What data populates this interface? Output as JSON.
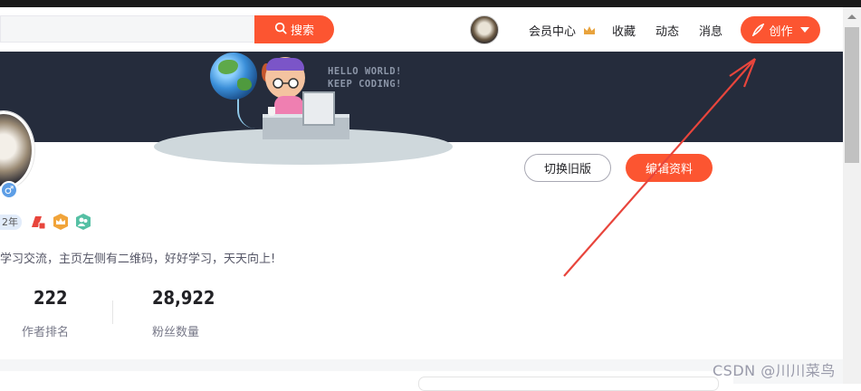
{
  "header": {
    "search": {
      "value": "",
      "placeholder": ""
    },
    "search_button_label": "搜索",
    "nav_items": [
      "会员中心",
      "收藏",
      "动态",
      "消息"
    ],
    "create_button_label": "创作"
  },
  "banner": {
    "text_line1": "HELLO WORLD!",
    "text_line2": "KEEP CODING!"
  },
  "profile": {
    "year_badge": "2年",
    "bio": "学习交流，主页左侧有二维码，好好学习，天天向上!",
    "actions": {
      "switch_label": "切换旧版",
      "edit_label": "编辑资料"
    },
    "stats": [
      {
        "value": "222",
        "label": "作者排名"
      },
      {
        "value": "28,922",
        "label": "粉丝数量"
      }
    ]
  },
  "watermark": "CSDN @川川菜鸟",
  "colors": {
    "accent": "#fc5531",
    "banner_bg": "#252c3c",
    "annotation_arrow": "#e8453c"
  },
  "icons": {
    "search": "search-icon",
    "crown": "crown-icon",
    "pen": "pen-icon",
    "gender": "male-icon"
  }
}
